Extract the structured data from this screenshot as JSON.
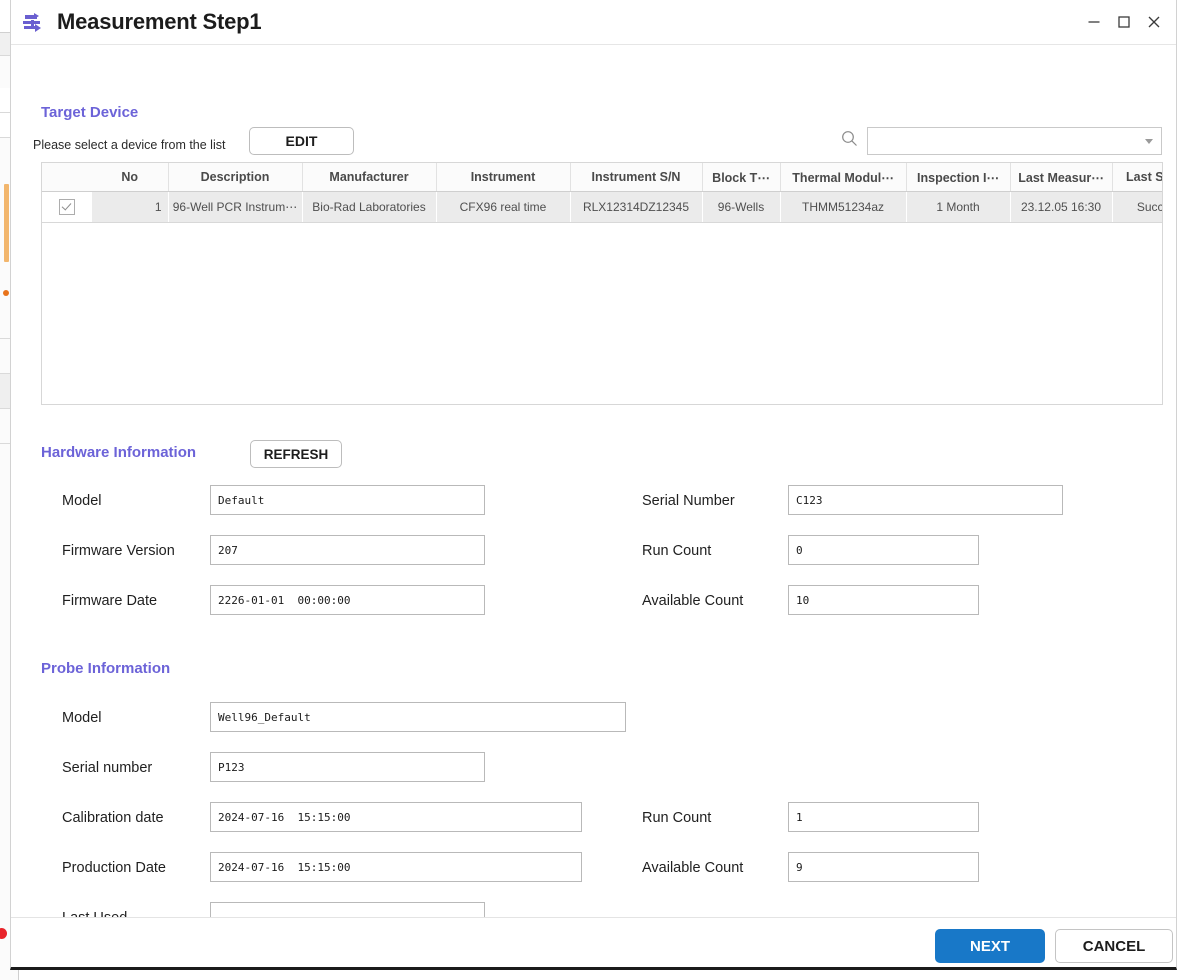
{
  "window": {
    "title": "Measurement Step1",
    "icon": "workflow-icon",
    "controls": {
      "minimize": "minimize-icon",
      "maximize": "maximize-icon",
      "close": "close-icon"
    }
  },
  "accent_color": "#6c63d8",
  "primary_button_color": "#1878c8",
  "target_device": {
    "heading": "Target Device",
    "hint": "Please select a device from the list",
    "edit_label": "EDIT",
    "search": {
      "icon": "search-icon",
      "value": "",
      "placeholder": "",
      "caret": "chevron-down-icon"
    },
    "columns": [
      "No",
      "Description",
      "Manufacturer",
      "Instrument",
      "Instrument S/N",
      "Block T⋯",
      "Thermal Modul⋯",
      "Inspection I⋯",
      "Last Measur⋯",
      "Last Status"
    ],
    "rows": [
      {
        "checked": true,
        "no": "1",
        "description": "96-Well PCR Instrum⋯",
        "manufacturer": "Bio-Rad Laboratories",
        "instrument": "CFX96 real time",
        "instrument_sn": "RLX12314DZ12345",
        "block_type": "96-Wells",
        "thermal_module": "THMM51234az",
        "inspection_interval": "1 Month",
        "last_measurement": "23.12.05 16:30",
        "last_status": "Success"
      }
    ]
  },
  "hardware_information": {
    "heading": "Hardware Information",
    "refresh_label": "REFRESH",
    "fields": {
      "model_label": "Model",
      "model_value": "Default",
      "firmware_version_label": "Firmware Version",
      "firmware_version_value": "207",
      "firmware_date_label": "Firmware Date",
      "firmware_date_value": "2226-01-01  00:00:00",
      "serial_number_label": "Serial Number",
      "serial_number_value": "C123",
      "run_count_label": "Run Count",
      "run_count_value": "0",
      "available_count_label": "Available Count",
      "available_count_value": "10"
    }
  },
  "probe_information": {
    "heading": "Probe Information",
    "fields": {
      "model_label": "Model",
      "model_value": "Well96_Default",
      "serial_number_label": "Serial number",
      "serial_number_value": "P123",
      "calibration_date_label": "Calibration date",
      "calibration_date_value": "2024-07-16  15:15:00",
      "production_date_label": "Production Date",
      "production_date_value": "2024-07-16  15:15:00",
      "last_used_label": "Last Used",
      "last_used_value": "",
      "run_count_label": "Run Count",
      "run_count_value": "1",
      "available_count_label": "Available Count",
      "available_count_value": "9"
    }
  },
  "footer": {
    "next_label": "NEXT",
    "cancel_label": "CANCEL"
  }
}
